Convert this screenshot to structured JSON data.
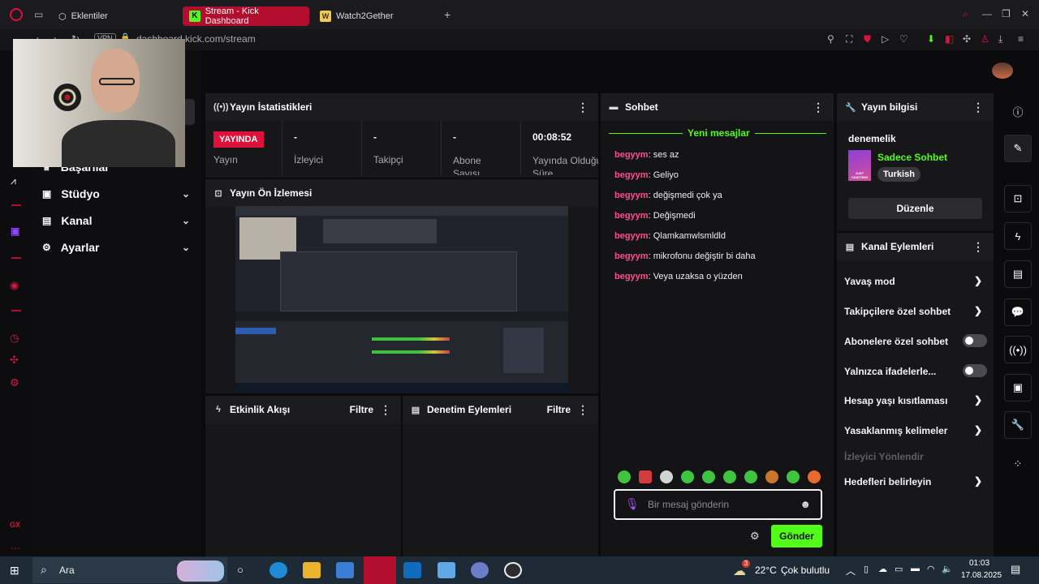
{
  "browser": {
    "tabs": [
      {
        "label": "Eklentiler",
        "icon": "cube-icon"
      },
      {
        "label": "Stream - Kick Dashboard",
        "icon": "kick-logo-icon",
        "active": true
      },
      {
        "label": "Watch2Gether",
        "icon": "watch2gether-icon"
      }
    ],
    "vpn_label": "VPN",
    "url": "dashboard.kick.com/stream"
  },
  "leftnav": {
    "items": [
      {
        "label": "Başarılar"
      },
      {
        "label": "Stüdyo"
      },
      {
        "label": "Kanal"
      },
      {
        "label": "Ayarlar"
      }
    ]
  },
  "stats_panel": {
    "title": "Yayın İstatistikleri",
    "live_badge": "YAYINDA",
    "live_label": "Yayın",
    "items": [
      {
        "value": "-",
        "label": "İzleyici"
      },
      {
        "value": "-",
        "label": "Takipçi"
      },
      {
        "value": "-",
        "label": "Abone Sayısı"
      },
      {
        "value": "00:08:52",
        "label": "Yayında Olduğu Süre"
      }
    ]
  },
  "preview_panel": {
    "title": "Yayın Ön İzlemesi"
  },
  "activity_panel": {
    "title": "Etkinlik Akışı",
    "filter": "Filtre"
  },
  "moderation_panel": {
    "title": "Denetim Eylemleri",
    "filter": "Filtre"
  },
  "chat": {
    "title": "Sohbet",
    "new_messages": "Yeni mesajlar",
    "messages": [
      {
        "user": "begyym",
        "text": "ses az"
      },
      {
        "user": "begyym",
        "text": "Geliyo"
      },
      {
        "user": "begyym",
        "text": "değişmedi çok ya"
      },
      {
        "user": "begyym",
        "text": "Değişmedi"
      },
      {
        "user": "begyym",
        "text": "Qlamkamwlsmldld"
      },
      {
        "user": "begyym",
        "text": "mikrofonu değiştir bi daha"
      },
      {
        "user": "begyym",
        "text": "Veya uzaksa o yüzden"
      }
    ],
    "input_placeholder": "Bir mesaj gönderin",
    "send_label": "Gönder"
  },
  "stream_info": {
    "title": "Yayın bilgisi",
    "stream_title": "denemelik",
    "category": "Sadece Sohbet",
    "tag": "Turkish",
    "edit_label": "Düzenle",
    "category_thumb_text": "JUST CHATTING"
  },
  "channel_actions": {
    "title": "Kanal Eylemleri",
    "items": [
      {
        "label": "Yavaş mod",
        "control": "chevron"
      },
      {
        "label": "Takipçilere özel sohbet",
        "control": "chevron"
      },
      {
        "label": "Abonelere özel sohbet",
        "control": "toggle",
        "on": false
      },
      {
        "label": "Yalnızca ifadelerle...",
        "control": "toggle",
        "on": false
      },
      {
        "label": "Hesap yaşı kısıtlaması",
        "control": "chevron"
      },
      {
        "label": "Yasaklanmış kelimeler",
        "control": "chevron"
      },
      {
        "label": "İzleyici Yönlendir",
        "control": "disabled"
      },
      {
        "label": "Hedefleri belirleyin",
        "control": "chevron"
      }
    ]
  },
  "taskbar": {
    "search_label": "Ara",
    "weather_temp": "22°C",
    "weather_text": "Çok bulutlu",
    "weather_badge": "3",
    "time": "01:03",
    "date": "17.08.2025"
  },
  "colors": {
    "accent_green": "#53fc18",
    "live_red": "#e0103a",
    "username_pink": "#ff4d8d",
    "opera_red": "#b30e2e"
  }
}
